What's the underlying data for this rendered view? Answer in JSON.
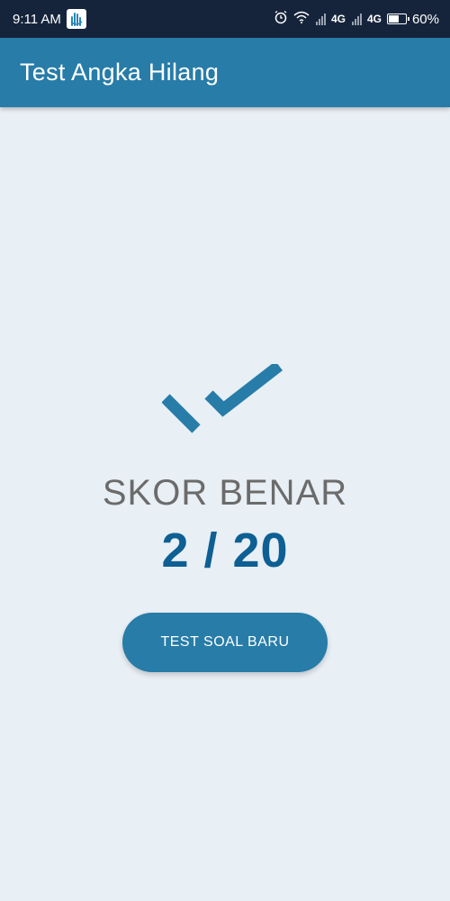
{
  "status_bar": {
    "time": "9:11 AM",
    "network_1": "4G",
    "network_2": "4G",
    "battery": "60%",
    "battery_level": 0.6,
    "icons": [
      "app-notification-icon",
      "alarm-icon",
      "wifi-icon",
      "signal-icon",
      "signal-icon",
      "battery-icon"
    ]
  },
  "app_bar": {
    "title": "Test Angka Hilang"
  },
  "result": {
    "icon": "double-check-icon",
    "label": "SKOR BENAR",
    "score": "2 / 20",
    "correct": 2,
    "total": 20
  },
  "actions": {
    "new_test_label": "TEST SOAL BARU"
  },
  "colors": {
    "status_bar": "#16243b",
    "app_bar": "#277ca8",
    "background": "#e8eff5",
    "score": "#0e5f93",
    "label": "#6b6b6b",
    "button": "#277ca8"
  }
}
